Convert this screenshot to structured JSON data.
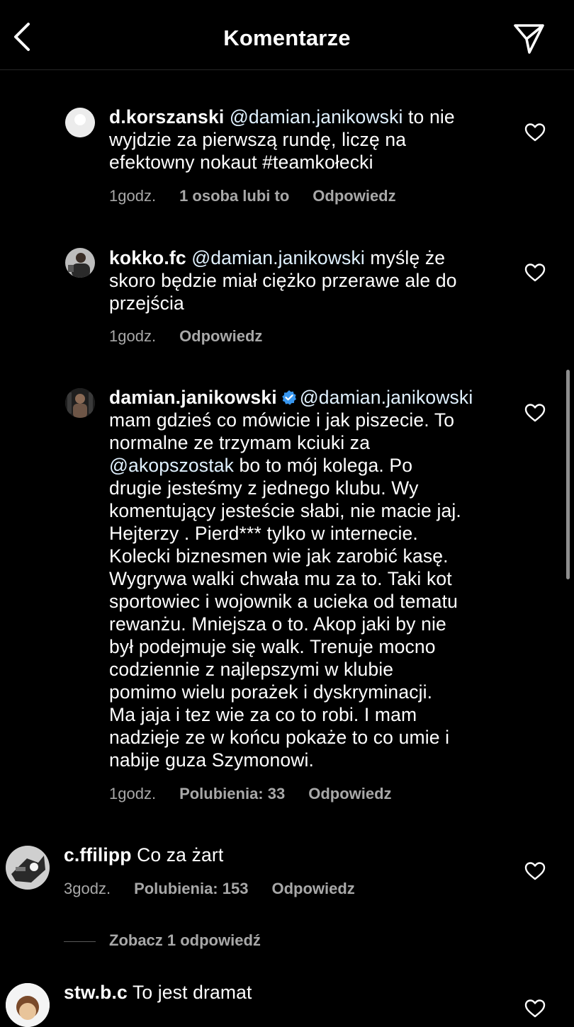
{
  "header": {
    "title": "Komentarze",
    "back_icon": "chevron-left-icon",
    "share_icon": "paper-plane-icon"
  },
  "comments": [
    {
      "username": "d.korszanski",
      "mention": "@damian.janikowski",
      "text_line1_rest": " to nie",
      "text_rest": "wyjdzie za pierwszą rundę, liczę na\nefektowny nokaut #teamkołecki",
      "time": "1godz.",
      "likes": "1 osoba lubi to",
      "reply": "Odpowiedz"
    },
    {
      "username": "kokko.fc",
      "mention": "@damian.janikowski",
      "text_line1_rest": " myślę że",
      "text_rest": "skoro będzie miał ciężko przerawe ale do\nprzejścia",
      "time": "1godz.",
      "reply": "Odpowiedz"
    },
    {
      "username": "damian.janikowski",
      "verified": true,
      "mention": "@damian.janikowski",
      "text_before_mention": "mam gdzieś co mówicie i jak piszecie. To\nnormalne ze trzymam kciuki za\n",
      "mention2": "@akopszostak",
      "text_after_mention": "  bo to mój kolega. Po\ndrugie jesteśmy z jednego klubu. Wy\nkomentujący jesteście słabi, nie macie jaj.\nHejterzy . Pierd*** tylko w internecie.\nKolecki biznesmen wie jak zarobić kasę.\nWygrywa walki chwała mu za to.  Taki kot\nsportowiec i wojownik a ucieka od tematu\nrewanżu. Mniejsza o to. Akop jaki by nie\nbył podejmuje się walk. Trenuje mocno\ncodziennie z najlepszymi w klubie\npomimo wielu porażek i dyskryminacji.\nMa jaja i tez wie za co to robi. I mam\nnadzieje ze w końcu pokaże to co umie i\nnabije guza Szymonowi.",
      "time": "1godz.",
      "likes": "Polubienia: 33",
      "reply": "Odpowiedz"
    },
    {
      "username": "c.ffilipp",
      "text": " Co za żart",
      "time": "3godz.",
      "likes": "Polubienia: 153",
      "reply": "Odpowiedz"
    },
    {
      "username": "stw.b.c",
      "text": " To jest dramat"
    }
  ],
  "view_replies": "Zobacz 1 odpowiedź",
  "colors": {
    "background": "#000000",
    "secondary_text": "#a8a8a8",
    "verified_badge": "#3897f0"
  }
}
